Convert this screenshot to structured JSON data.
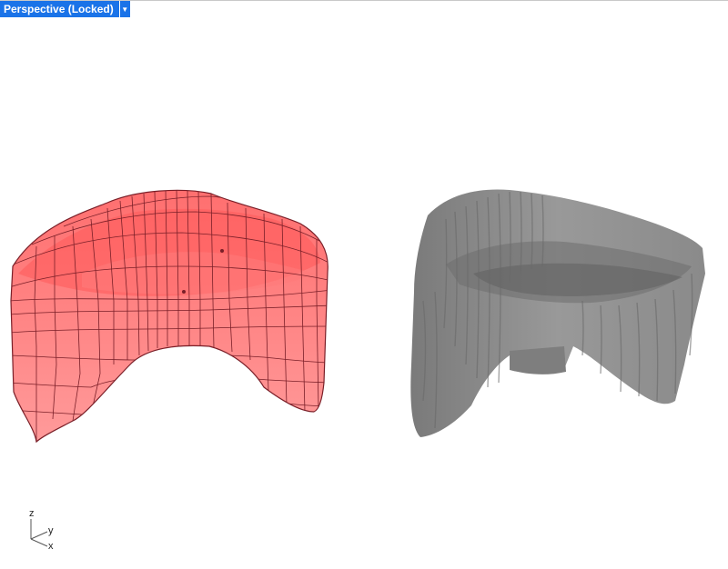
{
  "viewport": {
    "title": "Perspective (Locked)",
    "menu_icon": "caret-down-icon"
  },
  "objects": [
    {
      "name": "nurbs-surface-model",
      "display": "wireframe-shaded",
      "color": "#ff8c8c",
      "edge_color": "#7a1f28"
    },
    {
      "name": "subd-mesh-model",
      "display": "shaded",
      "color": "#8a8a8a"
    }
  ],
  "axis_widget": {
    "z_label": "z",
    "y_label": "y",
    "x_label": "x"
  }
}
